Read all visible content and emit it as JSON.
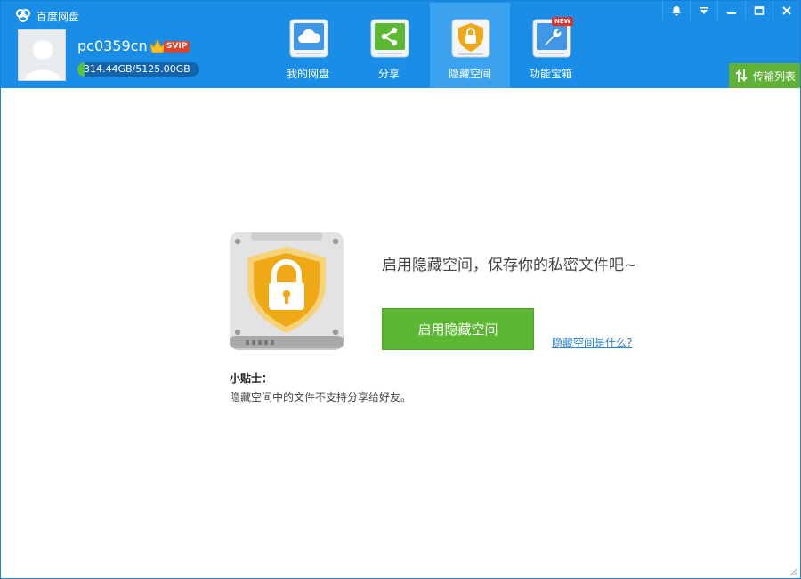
{
  "app": {
    "title": "百度网盘",
    "logo_icon": "cloud-logo-icon"
  },
  "user": {
    "name": "pc0359cn",
    "vip_label": "SVIP",
    "quota_text": "314.44GB/5125.00GB",
    "quota_fraction": 0.061
  },
  "nav": {
    "tabs": [
      {
        "label": "我的网盘",
        "icon": "cloud-icon"
      },
      {
        "label": "分享",
        "icon": "share-icon"
      },
      {
        "label": "隐藏空间",
        "icon": "lock-shield-icon",
        "active": true
      },
      {
        "label": "功能宝箱",
        "icon": "wrench-icon",
        "badge": "NEW"
      }
    ]
  },
  "transfer": {
    "label": "传输列表",
    "icon": "transfer-arrows-icon"
  },
  "main": {
    "headline": "启用隐藏空间，保存你的私密文件吧~",
    "enable_button": "启用隐藏空间",
    "what_link": "隐藏空间是什么?",
    "tip_title": "小贴士：",
    "tip_text": "隐藏空间中的文件不支持分享给好友。"
  },
  "colors": {
    "header_bg": "#1a8ee6",
    "active_tab_bg": "#3aa2ef",
    "primary_green": "#5cb832",
    "link_blue": "#2a85d8"
  }
}
